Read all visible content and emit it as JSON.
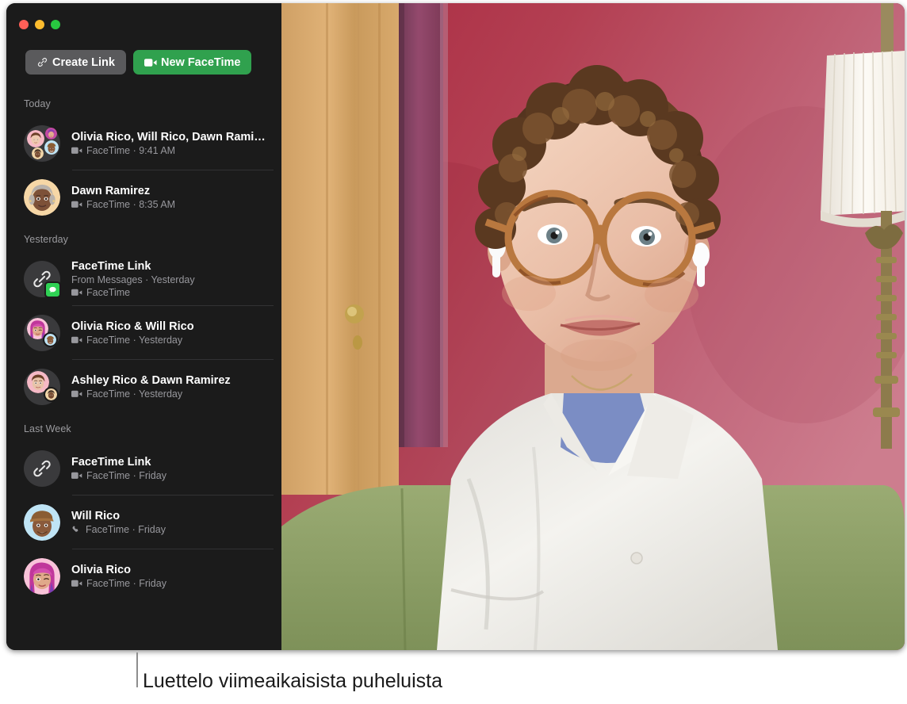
{
  "window": {
    "traffic_lights": [
      {
        "name": "close",
        "color": "#ff5f57"
      },
      {
        "name": "minimize",
        "color": "#febc2e"
      },
      {
        "name": "maximize",
        "color": "#28c840"
      }
    ]
  },
  "toolbar": {
    "create_link_label": "Create Link",
    "create_link_icon": "link-icon",
    "new_facetime_label": "New FaceTime",
    "new_facetime_icon": "video-camera-icon",
    "accent_color": "#30a14e",
    "secondary_color": "#5a5a5c"
  },
  "sidebar": {
    "sections": [
      {
        "header": "Today",
        "items": [
          {
            "title": "Olivia Rico, Will Rico, Dawn Rami…",
            "subtitle": "FaceTime · 9:41 AM",
            "call_icon": "video-camera-icon",
            "avatar": "group-four",
            "badge": null
          },
          {
            "title": "Dawn Ramirez",
            "subtitle": "FaceTime · 8:35 AM",
            "call_icon": "video-camera-icon",
            "avatar": "memoji-dawn",
            "badge": null
          }
        ]
      },
      {
        "header": "Yesterday",
        "items": [
          {
            "title": "FaceTime Link",
            "source": "From Messages · Yesterday",
            "subtitle": "FaceTime",
            "call_icon": "video-camera-icon",
            "avatar": "link-icon",
            "badge": "messages-badge"
          },
          {
            "title": "Olivia Rico & Will Rico",
            "subtitle": "FaceTime · Yesterday",
            "call_icon": "video-camera-icon",
            "avatar": "pair-olivia-will",
            "badge": null
          },
          {
            "title": "Ashley Rico & Dawn Ramirez",
            "subtitle": "FaceTime · Yesterday",
            "call_icon": "video-camera-icon",
            "avatar": "pair-ashley-dawn",
            "badge": null
          }
        ]
      },
      {
        "header": "Last Week",
        "items": [
          {
            "title": "FaceTime Link",
            "subtitle": "FaceTime · Friday",
            "call_icon": "video-camera-icon",
            "avatar": "link-icon",
            "badge": null
          },
          {
            "title": "Will Rico",
            "subtitle": "FaceTime · Friday",
            "call_icon": "phone-icon",
            "avatar": "memoji-will",
            "badge": null
          },
          {
            "title": "Olivia Rico",
            "subtitle": "FaceTime · Friday",
            "call_icon": "video-camera-icon",
            "avatar": "memoji-olivia",
            "badge": null
          }
        ]
      }
    ]
  },
  "video": {
    "description": "active-facetime-video-feed",
    "wall_color": "#b5495c",
    "door_color": "#d4a263",
    "trim_color": "#8e4368",
    "couch_color": "#8fa368",
    "shirt_color": "#f2f0ec",
    "tee_color": "#7b8dc4"
  },
  "callout": {
    "text": "Luettelo viimeaikaisista puheluista",
    "line_color": "#8e8e8e"
  }
}
